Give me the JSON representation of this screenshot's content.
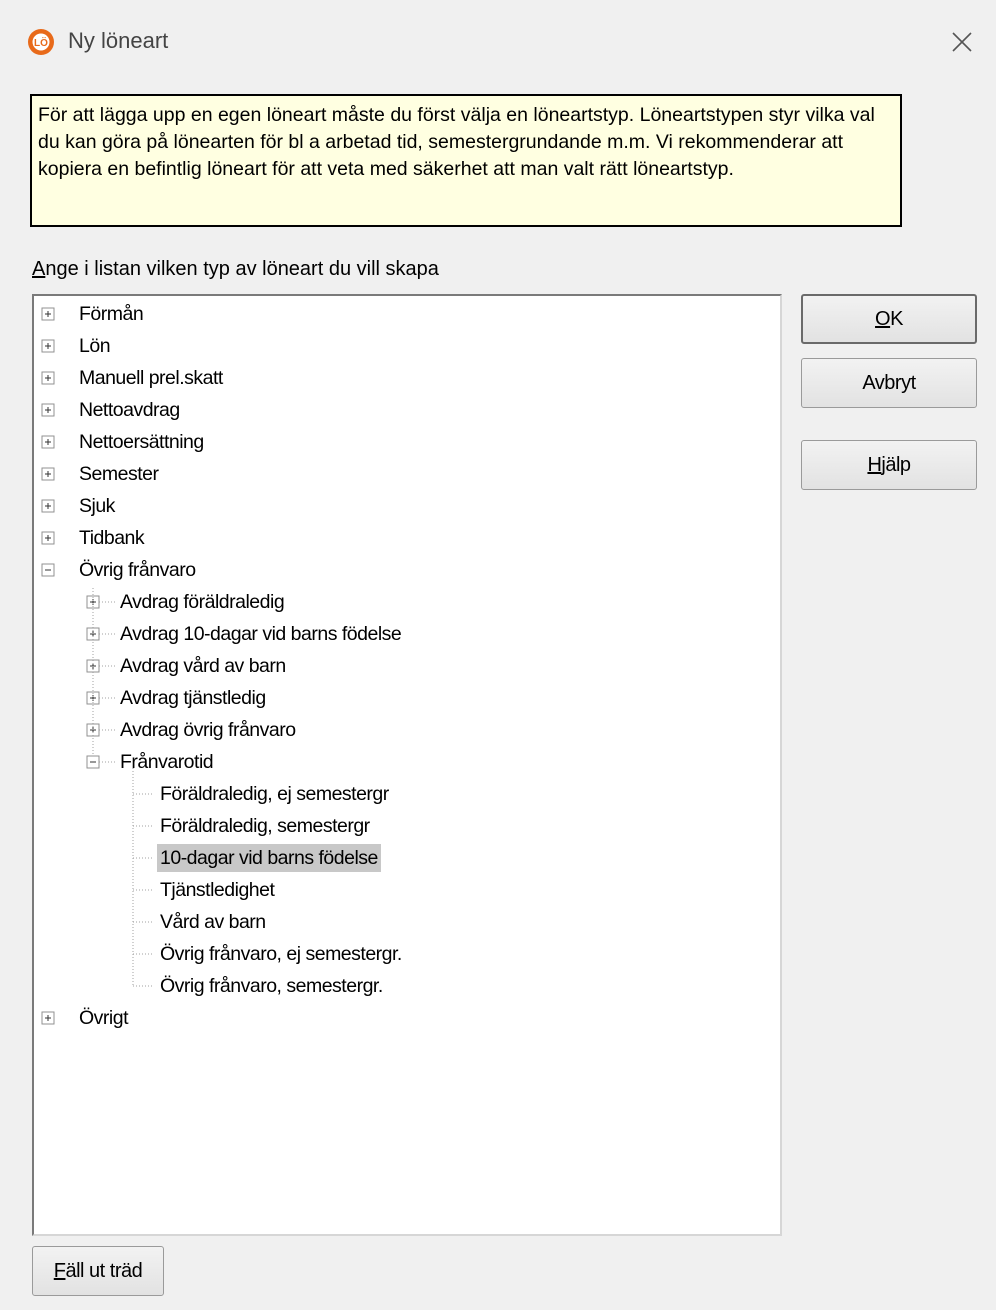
{
  "window": {
    "title": "Ny löneart",
    "app_icon_text": "LÖ"
  },
  "info_text": "För att lägga upp en egen löneart måste du först välja en löneartstyp. Löneartstypen styr vilka val du kan göra på lönearten för bl a arbetad tid, semestergrundande m.m. Vi rekommenderar att kopiera en befintlig löneart för att veta med säkerhet att man valt rätt löneartstyp.",
  "prompt": {
    "accel": "A",
    "rest": "nge i listan vilken typ av löneart du vill skapa"
  },
  "tree": {
    "level0": [
      "Förmån",
      "Lön",
      "Manuell prel.skatt",
      "Nettoavdrag",
      "Nettoersättning",
      "Semester",
      "Sjuk",
      "Tidbank",
      "Övrig frånvaro"
    ],
    "level1": [
      "Avdrag föräldraledig",
      "Avdrag 10-dagar vid barns födelse",
      "Avdrag vård av barn",
      "Avdrag tjänstledig",
      "Avdrag övrig frånvaro",
      "Frånvarotid"
    ],
    "level2": [
      "Föräldraledig, ej semestergr",
      "Föräldraledig, semestergr",
      "10-dagar vid barns födelse",
      "Tjänstledighet",
      "Vård av barn",
      "Övrig frånvaro, ej semestergr.",
      "Övrig frånvaro, semestergr."
    ],
    "last": "Övrigt",
    "selected": "10-dagar vid barns födelse"
  },
  "buttons": {
    "ok": {
      "accel": "O",
      "rest": "K"
    },
    "cancel": "Avbryt",
    "help": {
      "accel": "H",
      "rest": "jälp"
    },
    "expand": {
      "accel": "F",
      "rest": "äll ut träd"
    }
  }
}
